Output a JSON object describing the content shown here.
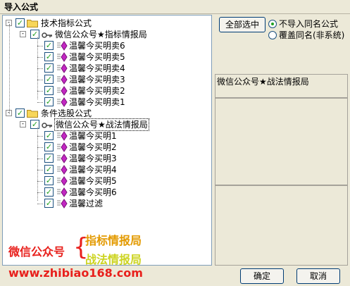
{
  "window": {
    "title": "导入公式"
  },
  "tree": {
    "groups": [
      {
        "label": "技术指标公式",
        "child": {
          "label": "微信公众号★指标情报局",
          "items": [
            "温馨今买明卖6",
            "温馨今买明卖5",
            "温馨今买明卖4",
            "温馨今买明卖3",
            "温馨今买明卖2",
            "温馨今买明卖1"
          ]
        }
      },
      {
        "label": "条件选股公式",
        "child": {
          "label": "微信公众号★战法情报局",
          "items": [
            "温馨今买明1",
            "温馨今买明2",
            "温馨今买明3",
            "温馨今买明4",
            "温馨今买明5",
            "温馨今买明6",
            "温馨过滤"
          ]
        }
      }
    ],
    "expander_open": "-",
    "check_mark": "✓"
  },
  "options": {
    "select_all": "全部选中",
    "radio_no_import": "不导入同名公式",
    "radio_overwrite": "覆盖同名(非系统)"
  },
  "info_panel": {
    "text": "微信公众号★战法情报局"
  },
  "watermark": {
    "label": "微信公众号",
    "brace": "{",
    "line1": "指标情报局",
    "line2": "战法情报局",
    "url": "www.zhibiao168.com",
    "color_red": "#e8201c",
    "color_gold": "#e39a00",
    "color_green": "#cdd422"
  },
  "buttons": {
    "ok": "确定",
    "cancel": "取消"
  }
}
